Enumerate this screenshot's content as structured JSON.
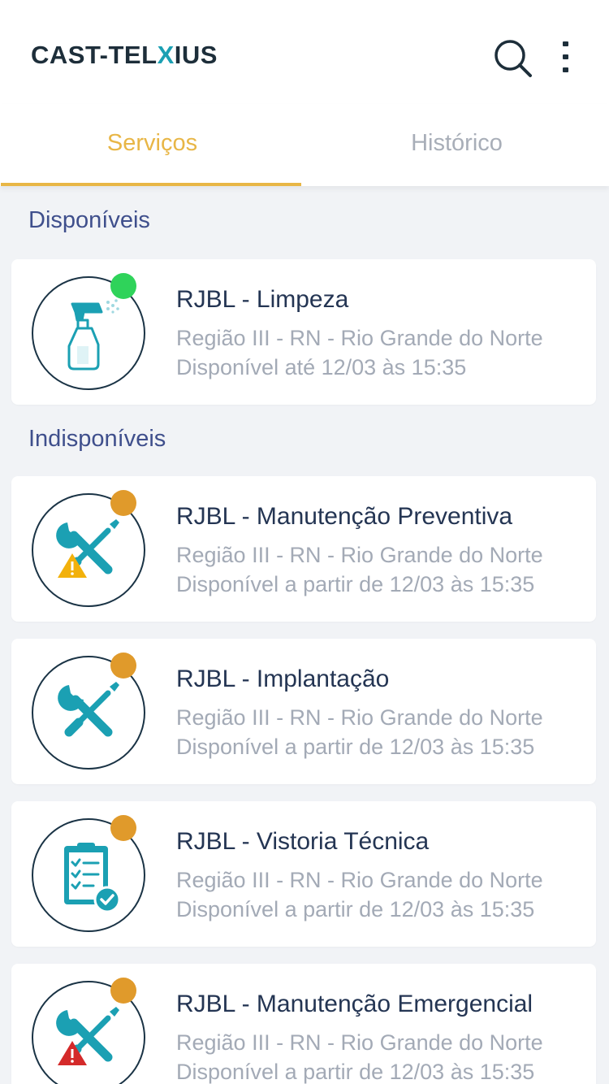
{
  "header": {
    "logo_prefix": "CAST-TEL",
    "logo_x": "X",
    "logo_suffix": "IUS",
    "icons": [
      "search-icon",
      "more-vertical-icon"
    ]
  },
  "tabs": [
    {
      "label": "Serviços",
      "active": true
    },
    {
      "label": "Histórico",
      "active": false
    }
  ],
  "colors": {
    "accent": "#e8b646",
    "teal": "#1ba0b3",
    "navy": "#1d2e3a",
    "available_dot": "#2fd35a",
    "unavailable_dot": "#e09a2b",
    "warning_yellow": "#f2b10c",
    "warning_red": "#d42a2a"
  },
  "sections": {
    "available": "Disponíveis",
    "unavailable": "Indisponíveis"
  },
  "services": [
    {
      "title": "RJBL - Limpeza",
      "region": "Região III - RN - Rio Grande do Norte",
      "availability": "Disponível até 12/03 às 15:35",
      "icon": "spray-bottle-icon",
      "status": "available"
    },
    {
      "title": "RJBL - Manutenção Preventiva",
      "region": "Região III - RN - Rio Grande do Norte",
      "availability": "Disponível a partir de 12/03 às 15:35",
      "icon": "tools-warning-icon",
      "status": "unavailable"
    },
    {
      "title": "RJBL - Implantação",
      "region": "Região III - RN - Rio Grande do Norte",
      "availability": "Disponível a partir de 12/03 às 15:35",
      "icon": "tools-icon",
      "status": "unavailable"
    },
    {
      "title": "RJBL - Vistoria Técnica",
      "region": "Região III - RN - Rio Grande do Norte",
      "availability": "Disponível a partir de 12/03 às 15:35",
      "icon": "clipboard-check-icon",
      "status": "unavailable"
    },
    {
      "title": "RJBL - Manutenção Emergencial",
      "region": "Região III - RN - Rio Grande do Norte",
      "availability": "Disponível a partir de 12/03 às 15:35",
      "icon": "tools-alert-icon",
      "status": "unavailable"
    }
  ]
}
